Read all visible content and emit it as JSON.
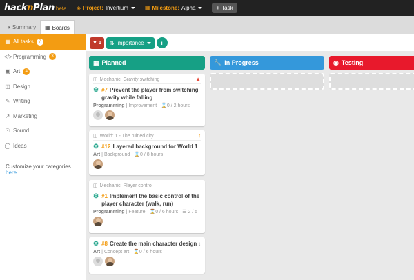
{
  "app": {
    "logo_text_1": "hack",
    "logo_text_2": "n",
    "logo_text_3": "Plan",
    "logo_beta": "beta",
    "project_label": "Project:",
    "project_value": "Invertium",
    "milestone_label": "Milestone:",
    "milestone_value": "Alpha",
    "task_button": "Task"
  },
  "tabs": [
    {
      "label": "Summary",
      "icon": "summary-icon"
    },
    {
      "label": "Boards",
      "icon": "boards-icon"
    }
  ],
  "sidebar": {
    "items": [
      {
        "label": "All tasks",
        "badge": "7",
        "icon": "grid-icon"
      },
      {
        "label": "Programming",
        "badge": "3",
        "icon": "code-icon"
      },
      {
        "label": "Art",
        "badge": "4",
        "icon": "image-icon"
      },
      {
        "label": "Design",
        "badge": "",
        "icon": "sitemap-icon"
      },
      {
        "label": "Writing",
        "badge": "",
        "icon": "pencil-icon"
      },
      {
        "label": "Marketing",
        "badge": "",
        "icon": "chart-icon"
      },
      {
        "label": "Sound",
        "badge": "",
        "icon": "headphones-icon"
      },
      {
        "label": "Ideas",
        "badge": "",
        "icon": "lightbulb-icon"
      }
    ],
    "note_text": "Customize your categories",
    "note_link": "here."
  },
  "toolbar": {
    "filter_count": "1",
    "sort_label": "Importance",
    "info_label": "i"
  },
  "columns": [
    {
      "title": "Planned",
      "icon": "calendar-icon"
    },
    {
      "title": "In Progress",
      "icon": "wrench-icon"
    },
    {
      "title": "Testing",
      "icon": "gamepad-icon"
    }
  ],
  "cards": [
    {
      "category": "Mechanic: Gravity switching",
      "flag": "▲",
      "flag_color": "#e74c3c",
      "number": "#7",
      "title": "Prevent the player from switching gravity while falling",
      "type": "Programming",
      "subtype": "Improvement",
      "estimate": "0 / 2 hours",
      "subtasks": ""
    },
    {
      "category": "World: 1 - The ruined city",
      "flag": "↑",
      "flag_color": "#f39c12",
      "number": "#12",
      "title": "Layered background for World 1",
      "type": "Art",
      "subtype": "Background",
      "estimate": "0 / 8 hours",
      "subtasks": ""
    },
    {
      "category": "Mechanic: Player control",
      "flag": "",
      "flag_color": "",
      "number": "#1",
      "title": "Implement the basic control of the player character (walk, run)",
      "type": "Programming",
      "subtype": "Feature",
      "estimate": "0 / 6 hours",
      "subtasks": "2 / 5"
    },
    {
      "category": "",
      "flag": "↓",
      "flag_color": "#888888",
      "number": "#8",
      "title": "Create the main character design",
      "type": "Art",
      "subtype": "Concept art",
      "estimate": "0 / 6 hours",
      "subtasks": ""
    }
  ],
  "colors": {
    "accent": "#f39c12",
    "teal": "#16a085",
    "blue": "#3498db",
    "red": "#e8192c"
  }
}
